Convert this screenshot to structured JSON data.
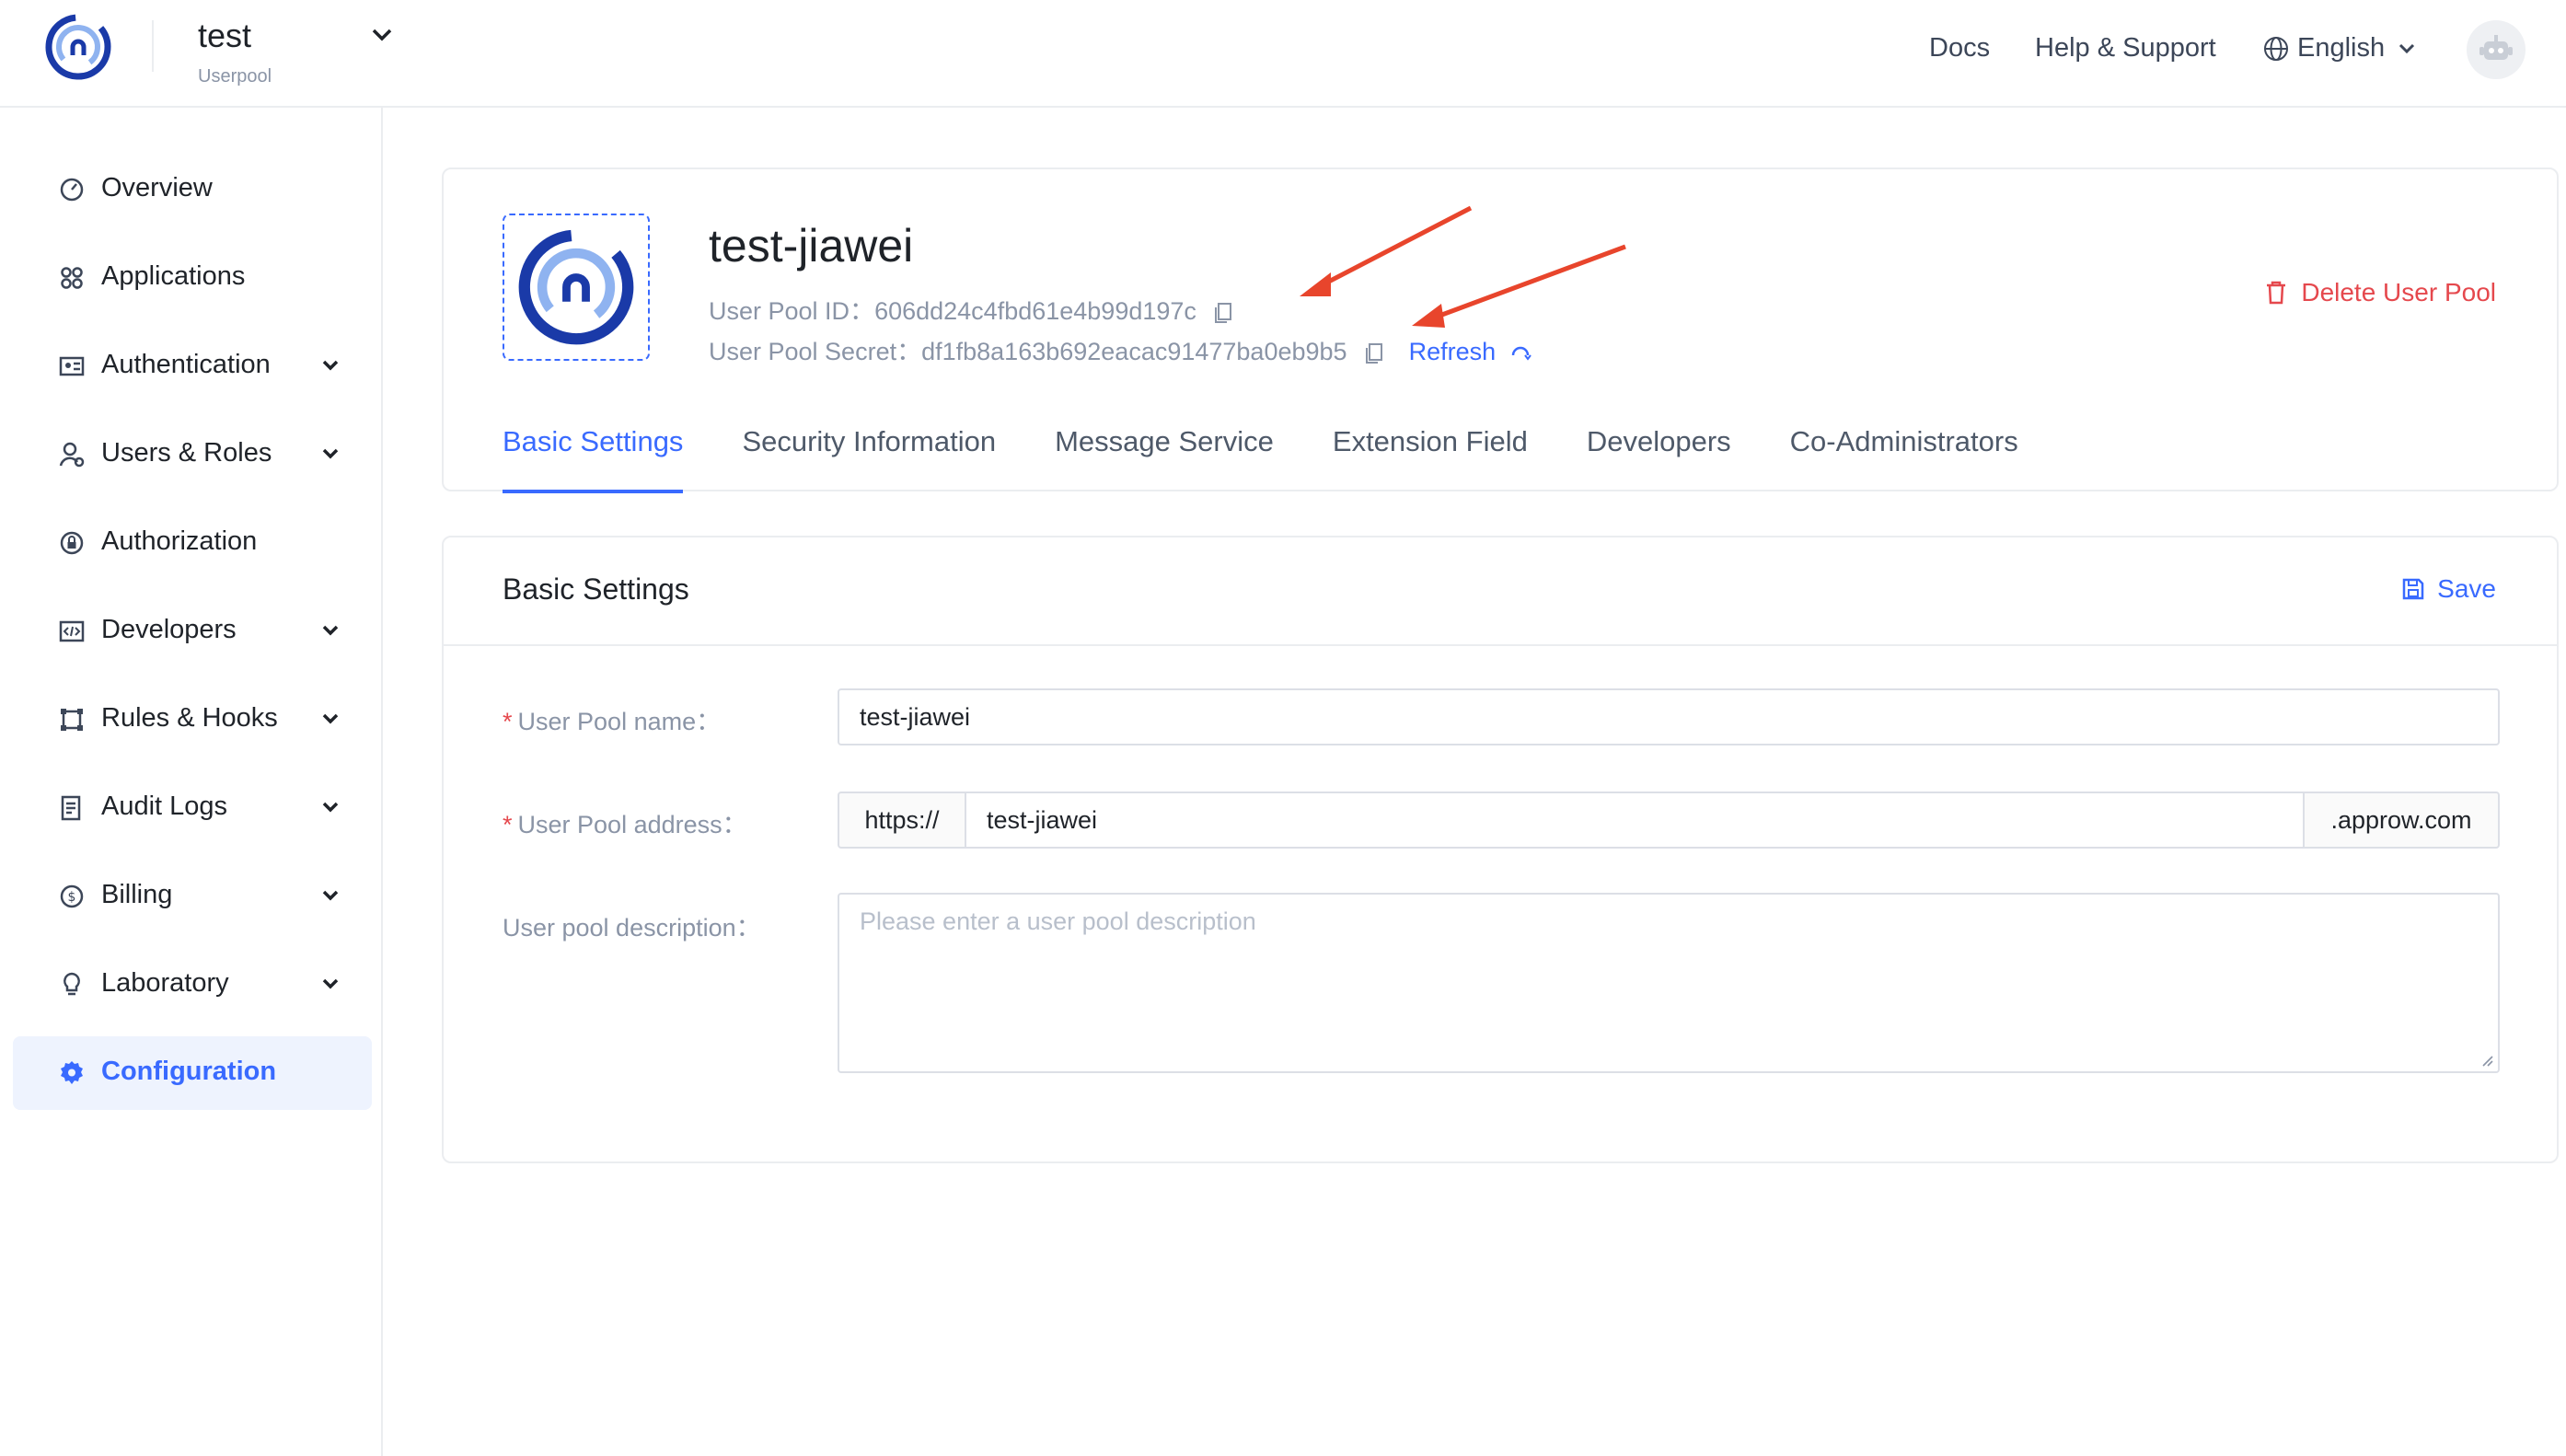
{
  "topbar": {
    "pool_name": "test",
    "pool_sub": "Userpool",
    "links": [
      "Docs",
      "Help & Support"
    ],
    "language": "English"
  },
  "sidebar": {
    "items": [
      {
        "label": "Overview",
        "icon": "gauge-icon",
        "expandable": false
      },
      {
        "label": "Applications",
        "icon": "grid-icon",
        "expandable": false
      },
      {
        "label": "Authentication",
        "icon": "id-card-icon",
        "expandable": true
      },
      {
        "label": "Users & Roles",
        "icon": "user-icon",
        "expandable": true
      },
      {
        "label": "Authorization",
        "icon": "lock-circle-icon",
        "expandable": false
      },
      {
        "label": "Developers",
        "icon": "code-icon",
        "expandable": true
      },
      {
        "label": "Rules & Hooks",
        "icon": "nodes-icon",
        "expandable": true
      },
      {
        "label": "Audit Logs",
        "icon": "log-icon",
        "expandable": true
      },
      {
        "label": "Billing",
        "icon": "coin-icon",
        "expandable": true
      },
      {
        "label": "Laboratory",
        "icon": "bulb-icon",
        "expandable": true
      },
      {
        "label": "Configuration",
        "icon": "gear-icon",
        "expandable": false,
        "active": true
      }
    ]
  },
  "header": {
    "title": "test-jiawei",
    "pool_id_label": "User Pool ID：",
    "pool_id": "606dd24c4fbd61e4b99d197c",
    "pool_secret_label": "User Pool Secret：",
    "pool_secret": "df1fb8a163b692eacac91477ba0eb9b5",
    "refresh_label": "Refresh",
    "delete_label": "Delete User Pool",
    "tabs": [
      "Basic Settings",
      "Security Information",
      "Message Service",
      "Extension Field",
      "Developers",
      "Co-Administrators"
    ],
    "active_tab": "Basic Settings"
  },
  "settings": {
    "title": "Basic Settings",
    "save_label": "Save",
    "name_label": "User Pool name：",
    "name_value": "test-jiawei",
    "address_label": "User Pool address：",
    "address_prefix": "https://",
    "address_value": "test-jiawei",
    "address_suffix": ".approw.com",
    "description_label": "User pool description：",
    "description_placeholder": "Please enter a user pool description"
  },
  "colors": {
    "accent": "#396aff",
    "danger": "#e5484d",
    "annotation_arrow": "#e8452c"
  }
}
